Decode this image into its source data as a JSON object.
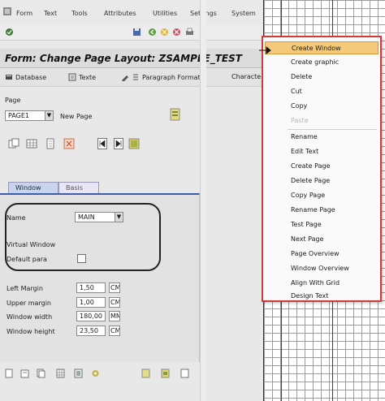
{
  "menu": [
    "Form",
    "Text",
    "Tools",
    "Attributes",
    "Utilities",
    "Settings",
    "System"
  ],
  "form_title": "Form: Change Page Layout: ZSAMPLE_TEST",
  "app_toolbar": [
    {
      "label": "Database",
      "icon": "database-icon"
    },
    {
      "label": "Texte",
      "icon": "text-icon"
    },
    {
      "label": "Paragraph Formats",
      "icon": "pen-icon"
    },
    {
      "label": "Characters",
      "icon": "character-icon"
    }
  ],
  "page": {
    "label": "Page",
    "value": "PAGE1",
    "new_page": "New Page"
  },
  "tabs": {
    "active": "Window",
    "inactive": "Basis"
  },
  "window_panel": {
    "name_label": "Name",
    "name_value": "MAIN",
    "virtual_window": "Virtual Window",
    "default_window": "Default para"
  },
  "dimensions": [
    {
      "label": "Left Margin",
      "value": "1,50",
      "unit": "CM"
    },
    {
      "label": "Upper margin",
      "value": "1,00",
      "unit": "CM"
    },
    {
      "label": "Window width",
      "value": "180,00",
      "unit": "MM"
    },
    {
      "label": "Window height",
      "value": "23,50",
      "unit": "CM"
    }
  ],
  "context_menu": [
    {
      "label": "Create Window",
      "highlight": true
    },
    {
      "label": "Create graphic"
    },
    {
      "label": "Delete"
    },
    {
      "label": "Cut"
    },
    {
      "label": "Copy"
    },
    {
      "label": "Paste"
    },
    {
      "label": "Rename"
    },
    {
      "label": "Edit Text"
    },
    {
      "label": "Create Page"
    },
    {
      "label": "Delete Page"
    },
    {
      "label": "Copy Page"
    },
    {
      "label": "Rename Page"
    },
    {
      "label": "Test Page"
    },
    {
      "label": "Next Page"
    },
    {
      "label": "Page Overview"
    },
    {
      "label": "Window Overview"
    },
    {
      "label": "Align With Grid"
    },
    {
      "label": "Design Text"
    }
  ],
  "colors": {
    "highlight": "#f6c879",
    "menu_border": "#d13a3a",
    "tab_active": "#c9d4ef",
    "panel_line": "#3d5fa8"
  }
}
